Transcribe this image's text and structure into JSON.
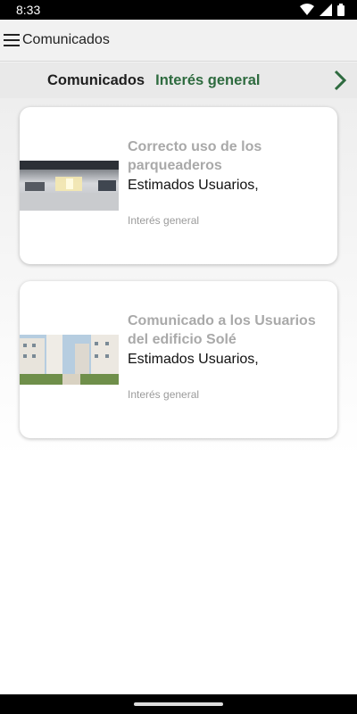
{
  "status": {
    "time": "8:33",
    "icons": [
      "wifi-icon",
      "signal-icon",
      "battery-icon"
    ]
  },
  "app_bar": {
    "title": "Comunicados",
    "icon": "menu-icon"
  },
  "tabs": {
    "items": [
      {
        "label": "Comunicados"
      },
      {
        "label": "Interés general"
      }
    ],
    "next_icon": "chevron-right-icon",
    "accent": "#2e6b3f"
  },
  "cards": [
    {
      "title": "Correcto uso de los parqueaderos",
      "excerpt": "Estimados Usuarios,",
      "category": "Interés general",
      "image": "parking-garage-photo"
    },
    {
      "title": "Comunicado a los Usuarios del edificio Solé",
      "excerpt": "Estimados Usuarios,",
      "category": "Interés general",
      "image": "apartment-buildings-photo"
    }
  ]
}
